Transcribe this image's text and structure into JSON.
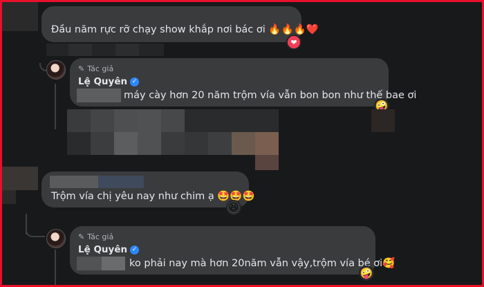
{
  "comments": [
    {
      "text": "Đầu năm rực rỡ chạy show khắp nơi bác ơi 🔥🔥🔥❤️",
      "reaction": "❤"
    },
    {
      "author_tag": "Tác giả",
      "author_name": "Lệ Quyên",
      "text": "máy cày hơn 20 năm trộm vía vẫn bon bon như thế bae ơi",
      "reaction": "🤪"
    },
    {
      "text": "Trộm vía chị yêu nay như chim ạ 🤩🤩🤩",
      "reaction": "😆"
    },
    {
      "author_tag": "Tác giả",
      "author_name": "Lệ Quyên",
      "text": "ko phải nay mà hơn 20năm vẫn vậy,trộm vía bé ơi🥰",
      "reaction": "🤪"
    }
  ],
  "colors": {
    "background": "#18191a",
    "bubble": "#3a3b3c",
    "text": "#e4e6eb",
    "secondary_text": "#b0b3b8",
    "verified": "#2d88ff",
    "heart": "#f33e58",
    "frame_border": "#e8102a"
  },
  "icons": {
    "pen": "pen-icon",
    "verified": "verified-badge-icon"
  }
}
